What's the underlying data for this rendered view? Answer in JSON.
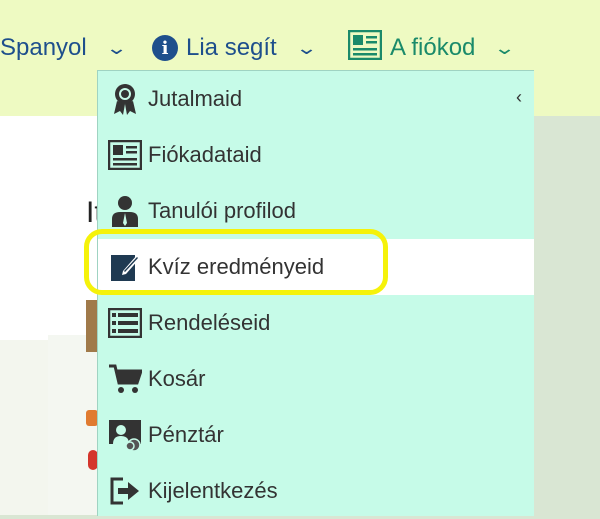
{
  "topnav": {
    "language_label": "Spanyol",
    "help_label": "Lia segít",
    "account_label": "A fiókod"
  },
  "colors": {
    "nav_text": "#1e4f8c",
    "account_text": "#1a8a6a",
    "menu_bg": "#c6fbe8",
    "highlight": "#f5f20a",
    "topbar_bg": "#eefac2"
  },
  "background": {
    "fragment_text": "It"
  },
  "menu": {
    "items": [
      {
        "label": "Jutalmaid",
        "icon": "award-icon"
      },
      {
        "label": "Fiókadataid",
        "icon": "id-card-icon"
      },
      {
        "label": "Tanulói profilod",
        "icon": "user-icon"
      },
      {
        "label": "Kvíz eredményeid",
        "icon": "edit-note-icon"
      },
      {
        "label": "Rendeléseid",
        "icon": "list-icon"
      },
      {
        "label": "Kosár",
        "icon": "cart-icon"
      },
      {
        "label": "Pénztár",
        "icon": "checkout-icon"
      },
      {
        "label": "Kijelentkezés",
        "icon": "logout-icon"
      }
    ],
    "active_index": 3
  }
}
